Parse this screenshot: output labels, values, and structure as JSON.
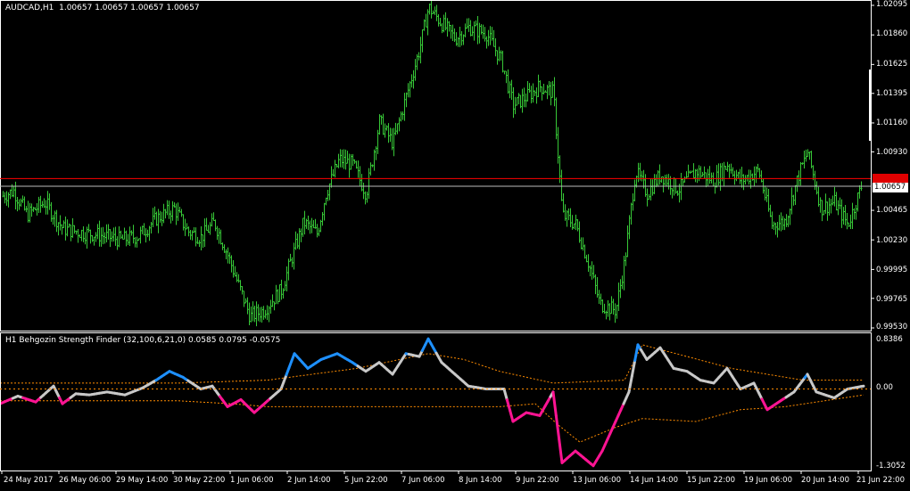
{
  "main_pane": {
    "title": "AUDCAD,H1  1.00657 1.00657 1.00657 1.00657",
    "price_ticks": [
      "1.02095",
      "1.01860",
      "1.01625",
      "1.01395",
      "1.01160",
      "1.00930",
      "1.00465",
      "1.00230",
      "0.99995",
      "0.99765",
      "0.99530"
    ],
    "red_line_price": "1.00718",
    "current_price": "1.00657"
  },
  "indicator_pane": {
    "title": "H1 Behgozin Strength Finder (32,100,6,21,0) 0.0585 0.0795 -0.0575",
    "ticks": [
      "0.8386",
      "0.00",
      "-1.3052"
    ]
  },
  "time_axis": [
    "24 May 2017",
    "26 May 06:00",
    "29 May 14:00",
    "30 May 22:00",
    "1 Jun 06:00",
    "2 Jun 14:00",
    "5 Jun 22:00",
    "7 Jun 06:00",
    "8 Jun 14:00",
    "9 Jun 22:00",
    "13 Jun 06:00",
    "14 Jun 14:00",
    "15 Jun 22:00",
    "19 Jun 06:00",
    "20 Jun 14:00",
    "21 Jun 22:00"
  ],
  "colors": {
    "background": "#000000",
    "bars": "#37c837",
    "red_line": "#ff0000",
    "grid_white": "#ffffff",
    "strong_up": "#1e90ff",
    "strong_down": "#ff1493",
    "neutral": "#c8c8c8",
    "bands": "#ff8c00"
  },
  "chart_data": [
    {
      "type": "bar",
      "title": "AUDCAD,H1",
      "ylim": [
        0.9953,
        1.02095
      ],
      "close_path": [
        [
          0,
          1.0057
        ],
        [
          15,
          1.0062
        ],
        [
          30,
          1.0043
        ],
        [
          50,
          1.0053
        ],
        [
          70,
          1.0032
        ],
        [
          90,
          1.0029
        ],
        [
          110,
          1.0027
        ],
        [
          135,
          1.0023
        ],
        [
          155,
          1.0026
        ],
        [
          175,
          1.004
        ],
        [
          195,
          1.0048
        ],
        [
          210,
          1.003
        ],
        [
          225,
          1.0025
        ],
        [
          240,
          1.0037
        ],
        [
          255,
          1.0011
        ],
        [
          268,
          0.9985
        ],
        [
          280,
          0.9962
        ],
        [
          295,
          0.9967
        ],
        [
          315,
          0.9983
        ],
        [
          325,
          1.0005
        ],
        [
          340,
          1.0037
        ],
        [
          355,
          1.0028
        ],
        [
          365,
          1.006
        ],
        [
          380,
          1.0087
        ],
        [
          395,
          1.0083
        ],
        [
          410,
          1.006
        ],
        [
          425,
          1.0117
        ],
        [
          440,
          1.01
        ],
        [
          455,
          1.0137
        ],
        [
          470,
          1.0175
        ],
        [
          480,
          1.0208
        ],
        [
          495,
          1.0195
        ],
        [
          510,
          1.0183
        ],
        [
          525,
          1.0192
        ],
        [
          545,
          1.0187
        ],
        [
          562,
          1.0165
        ],
        [
          575,
          1.013
        ],
        [
          590,
          1.0137
        ],
        [
          605,
          1.0145
        ],
        [
          620,
          1.014
        ],
        [
          630,
          1.0043
        ],
        [
          645,
          1.0035
        ],
        [
          660,
          1.0003
        ],
        [
          672,
          0.9972
        ],
        [
          690,
          0.9967
        ],
        [
          700,
          1.0007
        ],
        [
          712,
          1.0078
        ],
        [
          725,
          1.006
        ],
        [
          740,
          1.0075
        ],
        [
          760,
          1.0063
        ],
        [
          780,
          1.0078
        ],
        [
          800,
          1.007
        ],
        [
          815,
          1.0083
        ],
        [
          830,
          1.007
        ],
        [
          850,
          1.0078
        ],
        [
          865,
          1.0035
        ],
        [
          880,
          1.0038
        ],
        [
          895,
          1.0075
        ],
        [
          905,
          1.0093
        ],
        [
          920,
          1.0048
        ],
        [
          935,
          1.0053
        ],
        [
          950,
          1.0035
        ],
        [
          965,
          1.0065
        ]
      ]
    },
    {
      "type": "line",
      "title": "H1 Behgozin Strength Finder (32,100,6,21,0)",
      "ylim": [
        -1.3052,
        0.8386
      ],
      "series": [
        {
          "values": [
            [
              0,
              -0.25
            ],
            [
              20,
              -0.12
            ],
            [
              40,
              -0.22
            ],
            [
              60,
              0.05
            ],
            [
              70,
              -0.25
            ],
            [
              85,
              -0.08
            ],
            [
              100,
              -0.1
            ],
            [
              120,
              -0.05
            ],
            [
              140,
              -0.1
            ],
            [
              160,
              0.02
            ],
            [
              175,
              0.15
            ],
            [
              190,
              0.3
            ],
            [
              205,
              0.2
            ],
            [
              225,
              0.0
            ],
            [
              238,
              0.05
            ],
            [
              255,
              -0.3
            ],
            [
              270,
              -0.18
            ],
            [
              285,
              -0.4
            ],
            [
              300,
              -0.2
            ],
            [
              315,
              0.0
            ],
            [
              330,
              0.6
            ],
            [
              345,
              0.35
            ],
            [
              360,
              0.5
            ],
            [
              378,
              0.6
            ],
            [
              395,
              0.45
            ],
            [
              410,
              0.3
            ],
            [
              425,
              0.45
            ],
            [
              440,
              0.25
            ],
            [
              455,
              0.6
            ],
            [
              470,
              0.55
            ],
            [
              480,
              0.85
            ],
            [
              495,
              0.45
            ],
            [
              510,
              0.25
            ],
            [
              525,
              0.05
            ],
            [
              545,
              0.0
            ],
            [
              565,
              0.0
            ],
            [
              575,
              -0.55
            ],
            [
              590,
              -0.4
            ],
            [
              605,
              -0.45
            ],
            [
              620,
              -0.05
            ],
            [
              630,
              -1.25
            ],
            [
              645,
              -1.05
            ],
            [
              665,
              -1.3
            ],
            [
              675,
              -1.05
            ],
            [
              690,
              -0.55
            ],
            [
              705,
              -0.05
            ],
            [
              715,
              0.75
            ],
            [
              725,
              0.5
            ],
            [
              740,
              0.7
            ],
            [
              755,
              0.35
            ],
            [
              770,
              0.3
            ],
            [
              785,
              0.15
            ],
            [
              800,
              0.1
            ],
            [
              815,
              0.35
            ],
            [
              830,
              0.0
            ],
            [
              845,
              0.1
            ],
            [
              860,
              -0.35
            ],
            [
              875,
              -0.2
            ],
            [
              890,
              -0.05
            ],
            [
              905,
              0.25
            ],
            [
              915,
              -0.05
            ],
            [
              935,
              -0.15
            ],
            [
              950,
              0.0
            ],
            [
              968,
              0.05
            ]
          ]
        },
        {
          "values": [
            [
              0,
              0.1
            ],
            [
              100,
              0.1
            ],
            [
              200,
              0.1
            ],
            [
              300,
              0.15
            ],
            [
              400,
              0.35
            ],
            [
              480,
              0.6
            ],
            [
              520,
              0.5
            ],
            [
              560,
              0.3
            ],
            [
              620,
              0.1
            ],
            [
              700,
              0.15
            ],
            [
              720,
              0.75
            ],
            [
              770,
              0.55
            ],
            [
              820,
              0.35
            ],
            [
              900,
              0.15
            ],
            [
              968,
              0.15
            ]
          ]
        },
        {
          "values": [
            [
              0,
              -0.2
            ],
            [
              100,
              -0.2
            ],
            [
              200,
              -0.2
            ],
            [
              260,
              -0.25
            ],
            [
              300,
              -0.3
            ],
            [
              360,
              -0.3
            ],
            [
              420,
              -0.3
            ],
            [
              500,
              -0.3
            ],
            [
              560,
              -0.3
            ],
            [
              600,
              -0.25
            ],
            [
              625,
              -0.6
            ],
            [
              650,
              -0.9
            ],
            [
              690,
              -0.65
            ],
            [
              720,
              -0.5
            ],
            [
              780,
              -0.55
            ],
            [
              830,
              -0.35
            ],
            [
              880,
              -0.3
            ],
            [
              968,
              -0.1
            ]
          ]
        }
      ]
    }
  ]
}
